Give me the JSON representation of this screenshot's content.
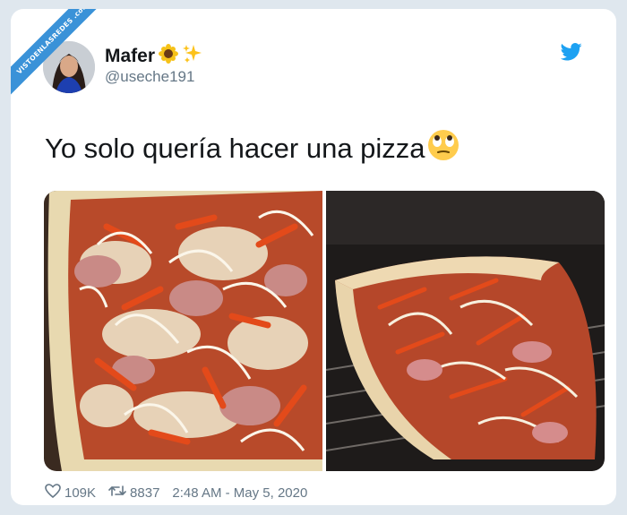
{
  "watermark": {
    "text": "VISTOENLASREDES .com"
  },
  "user": {
    "name": "Mafer",
    "name_emojis": [
      "sunflower-emoji",
      "sparkles-emoji"
    ],
    "handle": "@useche191"
  },
  "tweet": {
    "text": "Yo solo quería hacer una pizza",
    "text_emoji": "face-with-rolling-eyes-emoji"
  },
  "photos": [
    {
      "description": "pizza-with-onion-ham-peppers"
    },
    {
      "description": "pizza-collapsed-through-oven-rack"
    }
  ],
  "stats": {
    "likes": "109K",
    "retweets": "8837",
    "timestamp": "2:48 AM - May 5, 2020"
  },
  "colors": {
    "brand": "#1da1f2",
    "ribbon": "#3a92d8",
    "text": "#14171a",
    "secondary": "#657786"
  }
}
